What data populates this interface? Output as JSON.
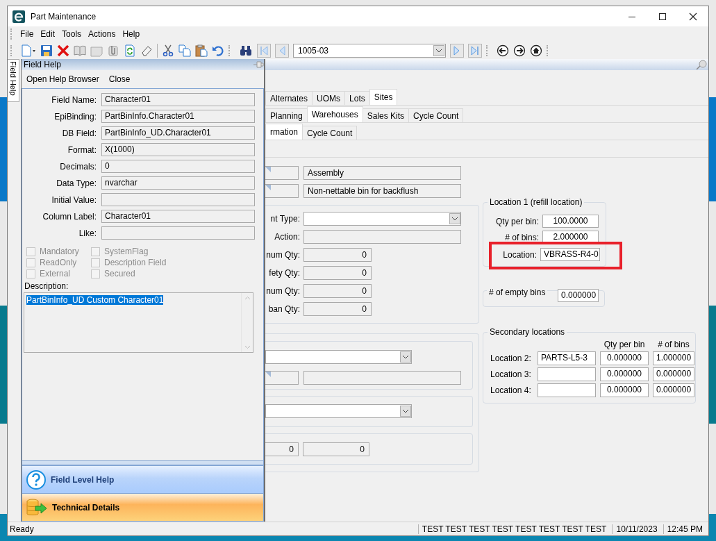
{
  "window": {
    "title": "Part Maintenance"
  },
  "menu": [
    "File",
    "Edit",
    "Tools",
    "Actions",
    "Help"
  ],
  "toolbar": {
    "record": "1005-03"
  },
  "side_tab": {
    "label": "Field Help"
  },
  "field_help": {
    "title": "Field Help",
    "actions": [
      "Open Help Browser",
      "Close"
    ],
    "fields": [
      {
        "label": "Field Name:",
        "value": "Character01"
      },
      {
        "label": "EpiBinding:",
        "value": "PartBinInfo.Character01"
      },
      {
        "label": "DB Field:",
        "value": "PartBinInfo_UD.Character01"
      },
      {
        "label": "Format:",
        "value": "X(1000)"
      },
      {
        "label": "Decimals:",
        "value": "0"
      },
      {
        "label": "Data Type:",
        "value": "nvarchar"
      },
      {
        "label": "Initial Value:"
      },
      {
        "label": "Column Label:",
        "value": "Character01"
      },
      {
        "label": "Like:"
      }
    ],
    "flags": [
      {
        "label": "Mandatory",
        "checked": false,
        "disabled": true
      },
      {
        "label": "SystemFlag",
        "checked": false,
        "disabled": true
      },
      {
        "label": "ReadOnly",
        "checked": false,
        "disabled": true
      },
      {
        "label": "Description Field",
        "checked": false,
        "disabled": true
      },
      {
        "label": "External",
        "checked": false,
        "disabled": true
      },
      {
        "label": "Secured",
        "checked": false,
        "disabled": true
      }
    ],
    "description_label": "Description:",
    "description": "PartBinInfo_UD Custom Character01",
    "sections": [
      {
        "label": "Field Level Help",
        "kind": "help"
      },
      {
        "label": "Technical Details",
        "kind": "technical"
      }
    ]
  },
  "tab_rows": [
    [
      {
        "label": "Alternates",
        "selected": false
      },
      {
        "label": "UOMs",
        "selected": false
      },
      {
        "label": "Lots",
        "selected": false
      },
      {
        "label": "Sites",
        "selected": true
      }
    ],
    [
      {
        "label": "Planning",
        "selected": false
      },
      {
        "label": "Warehouses",
        "selected": true
      },
      {
        "label": "Sales Kits",
        "selected": false
      },
      {
        "label": "Cycle Count",
        "selected": false
      }
    ],
    [
      {
        "label": "rmation",
        "selected": true
      },
      {
        "label": "Cycle Count",
        "selected": false
      }
    ]
  ],
  "header_fields": [
    {
      "description": "Assembly"
    },
    {
      "description": "Non-nettable bin for backflush"
    }
  ],
  "settings": [
    {
      "label": "nt Type:",
      "kind": "combo"
    },
    {
      "label": "Action:",
      "kind": "text"
    },
    {
      "label": "num Qty:",
      "kind": "number",
      "value": "0"
    },
    {
      "label": "fety Qty:",
      "kind": "number",
      "value": "0"
    },
    {
      "label": "num Qty:",
      "kind": "number",
      "value": "0"
    },
    {
      "label": "ban Qty:",
      "kind": "number",
      "value": "0"
    }
  ],
  "lower_values": [
    "0",
    "0"
  ],
  "location1": {
    "title": "Location 1 (refill location)",
    "qty_label": "Qty per bin:",
    "qty": "100.0000",
    "bins_label": "# of bins:",
    "bins": "2.000000",
    "location_label": "Location:",
    "location": "VBRASS-R4-0",
    "highlighted": true
  },
  "empty_bins": {
    "label": "# of empty bins",
    "value": "0.000000"
  },
  "secondary": {
    "title": "Secondary locations",
    "columns": [
      "Qty per bin",
      "# of bins"
    ],
    "rows": [
      {
        "label": "Location 2:",
        "location": "PARTS-L5-3",
        "qty": "0.000000",
        "bins": "1.000000"
      },
      {
        "label": "Location 3:",
        "qty": "0.000000",
        "bins": "0.000000"
      },
      {
        "label": "Location 4:",
        "qty": "0.000000",
        "bins": "0.000000"
      }
    ]
  },
  "status_bar": {
    "text": "Ready",
    "panels": [
      "TEST TEST TEST TEST TEST TEST TEST TEST",
      "10/11/2023",
      "12:45 PM"
    ]
  }
}
